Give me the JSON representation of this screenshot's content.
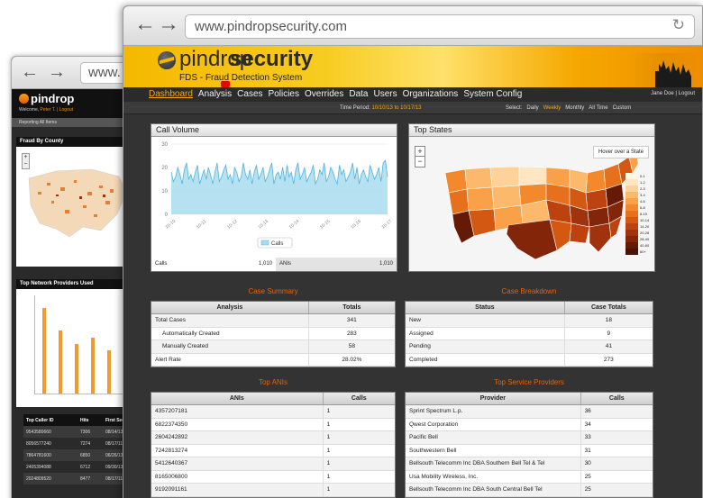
{
  "back_window": {
    "url": "www.",
    "logo": "pindrop",
    "welcome_prefix": "Welcome,",
    "welcome_user": "Peter T. | Logout",
    "tabs": "Reporting  All Items",
    "panel1_title": "Fraud By County",
    "panel2_title": "Top Network Providers Used",
    "table_headers": [
      "Top Caller ID",
      "Hits",
      "First Seen"
    ],
    "table_rows": [
      [
        "9543580660",
        "7306",
        "08/14/13"
      ],
      [
        "8056577240",
        "7274",
        "08/17/11"
      ],
      [
        "7864781600",
        "6850",
        "06/26/13"
      ],
      [
        "2405394088",
        "6712",
        "09/30/13"
      ],
      [
        "2024809520",
        "8477",
        "08/17/11"
      ]
    ]
  },
  "browser": {
    "url": "www.pindropsecurity.com"
  },
  "banner": {
    "logo_part1": "pindrop",
    "logo_part2": "security",
    "subtitle": "FDS - Fraud Detection System"
  },
  "nav": {
    "items": [
      "Dashboard",
      "Analysis",
      "Cases",
      "Policies",
      "Overrides",
      "Data",
      "Users",
      "Organizations",
      "System Config"
    ],
    "user": "Jane Doe | Logout"
  },
  "period": {
    "label": "Time Period:",
    "range": "10/10/13 to 10/17/13",
    "select_label": "Select:",
    "options": [
      "Daily",
      "Weekly",
      "Monthly",
      "All Time",
      "Custom"
    ],
    "selected": "Weekly"
  },
  "call_volume": {
    "title": "Call Volume",
    "legend": "Calls",
    "footer_calls_label": "Calls",
    "footer_calls_value": "1,010",
    "footer_anis_label": "ANIs",
    "footer_anis_value": "1,010"
  },
  "chart_data": {
    "type": "area",
    "title": "Call Volume",
    "series": [
      {
        "name": "Calls",
        "values": [
          18,
          14,
          16,
          20,
          17,
          13,
          19,
          22,
          15,
          17,
          14,
          18,
          21,
          13,
          16,
          19,
          15,
          20,
          17,
          13,
          18,
          22,
          14,
          16,
          19,
          21,
          15,
          17,
          13,
          20,
          18,
          14,
          16,
          22,
          17,
          15,
          19,
          13,
          18,
          21,
          15,
          17,
          20,
          14,
          16,
          19,
          22,
          13,
          17,
          18,
          15,
          20,
          14,
          21,
          16,
          18,
          13,
          19,
          22,
          15,
          17,
          20,
          14,
          16,
          18,
          21,
          13,
          15,
          19,
          17,
          22,
          14,
          16,
          20,
          18,
          15,
          13,
          21,
          17,
          19,
          14,
          16,
          18,
          22,
          15,
          20,
          13,
          17,
          19,
          16,
          14,
          21,
          18,
          15,
          17,
          20,
          14,
          22,
          23,
          16
        ]
      }
    ],
    "ylim": [
      0,
      30
    ],
    "yticks": [
      "30",
      "20",
      "10",
      "0"
    ],
    "xticks": [
      "10-10",
      "10-11",
      "10-12",
      "10-13",
      "10-14",
      "10-15",
      "10-16",
      "10-17"
    ],
    "color": "#a8dcef"
  },
  "top_states": {
    "title": "Top States",
    "hover_text": "Hover over a State",
    "legend_labels": [
      "0-1",
      "1-2",
      "2-3",
      "3-4",
      "4-6",
      "6-8",
      "8-10",
      "10-14",
      "14-20",
      "20-28",
      "28-40",
      "40-60",
      "60+"
    ],
    "legend_colors": [
      "#fff5e6",
      "#ffe6c2",
      "#ffd29a",
      "#fcb96b",
      "#f9a049",
      "#f28a2d",
      "#e6701c",
      "#d35913",
      "#bc430f",
      "#a0320d",
      "#832509",
      "#651a06",
      "#4a1104"
    ]
  },
  "case_summary": {
    "title": "Case Summary",
    "headers": [
      "Analysis",
      "Totals"
    ],
    "rows": [
      {
        "label": "Total Cases",
        "value": "341",
        "indent": false
      },
      {
        "label": "Automatically Created",
        "value": "283",
        "indent": true
      },
      {
        "label": "Manually Created",
        "value": "58",
        "indent": true
      },
      {
        "label": "Alert Rate",
        "value": "28.02%",
        "indent": false
      }
    ]
  },
  "case_breakdown": {
    "title": "Case Breakdown",
    "headers": [
      "Status",
      "Case Totals"
    ],
    "rows": [
      {
        "label": "New",
        "value": "18"
      },
      {
        "label": "Assigned",
        "value": "9"
      },
      {
        "label": "Pending",
        "value": "41"
      },
      {
        "label": "Completed",
        "value": "273"
      }
    ]
  },
  "top_anis": {
    "title": "Top ANIs",
    "headers": [
      "ANIs",
      "Calls"
    ],
    "rows": [
      {
        "ani": "4357207181",
        "calls": "1"
      },
      {
        "ani": "6822374350",
        "calls": "1"
      },
      {
        "ani": "2604242892",
        "calls": "1"
      },
      {
        "ani": "7242813274",
        "calls": "1"
      },
      {
        "ani": "5412640367",
        "calls": "1"
      },
      {
        "ani": "8165006800",
        "calls": "1"
      },
      {
        "ani": "9192091161",
        "calls": "1"
      }
    ]
  },
  "top_providers": {
    "title": "Top Service Providers",
    "headers": [
      "Provider",
      "Calls"
    ],
    "rows": [
      {
        "name": "Sprint Spectrum L.p.",
        "calls": "36"
      },
      {
        "name": "Qwest Corporation",
        "calls": "34"
      },
      {
        "name": "Pacific Bell",
        "calls": "33"
      },
      {
        "name": "Southwestern Bell",
        "calls": "31"
      },
      {
        "name": "Bellsouth Telecomm Inc DBA Southern Bell Tel & Tel",
        "calls": "30"
      },
      {
        "name": "Usa Mobility Wireless, Inc.",
        "calls": "25"
      },
      {
        "name": "Bellsouth Telecomm Inc DBA South Central Bell Tel",
        "calls": "25"
      }
    ]
  }
}
